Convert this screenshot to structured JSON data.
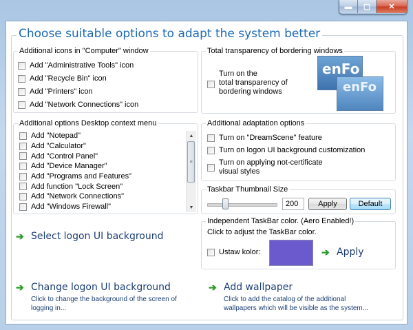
{
  "window": {
    "minimize_glyph": "▬",
    "maximize_glyph": "▢",
    "close_glyph": "✕"
  },
  "main": {
    "title": "Choose suitable options to adapt the system better"
  },
  "computer_icons": {
    "caption": "Additional icons in \"Computer\" window",
    "items": [
      {
        "label": "Add \"Administrative Tools\" icon",
        "checked": false
      },
      {
        "label": "Add \"Recycle Bin\" icon",
        "checked": false
      },
      {
        "label": "Add \"Printers\" icon",
        "checked": false
      },
      {
        "label": "Add \"Network Connections\" icon",
        "checked": false
      }
    ]
  },
  "transparency": {
    "caption": "Total transparency of bordering windows",
    "label": "Turn on the\ntotal transparency of\nbordering windows",
    "checked": false,
    "preview_text": "enFo"
  },
  "context_menu": {
    "caption": "Additional options Desktop context menu",
    "items": [
      {
        "label": "Add \"Notepad\""
      },
      {
        "label": "Add \"Calculator\""
      },
      {
        "label": "Add \"Control Panel\""
      },
      {
        "label": "Add \"Device Manager\""
      },
      {
        "label": "Add \"Programs and Features\""
      },
      {
        "label": "Add function \"Lock Screen\""
      },
      {
        "label": "Add \"Network Connections\""
      },
      {
        "label": "Add \"Windows Firewall\""
      }
    ],
    "scroll_up": "▲",
    "scroll_down": "▼",
    "grip": "≡"
  },
  "adaptation": {
    "caption": "Additional adaptation options",
    "items": [
      {
        "label": "Turn on \"DreamScene\" feature"
      },
      {
        "label": "Turn on logon UI background customization"
      },
      {
        "label": "Turn on applying not-certificate\nvisual styles"
      }
    ]
  },
  "thumbnail": {
    "caption": "Taskbar Thumbnail Size",
    "value": "200",
    "slider_fraction": 0.25,
    "apply_label": "Apply",
    "default_label": "Default"
  },
  "taskbar_color": {
    "caption": "Independent TaskBar color. (Aero Enabled!)",
    "hint": "Click to adjust the TaskBar color.",
    "checkbox_label": "Ustaw kolor:",
    "swatch_color": "#6a5acd",
    "apply_label": "Apply"
  },
  "links": {
    "select_logon": {
      "label": "Select logon UI background"
    },
    "change_logon": {
      "label": "Change logon UI background",
      "desc": "Click to change the background of the screen of\nlogging in..."
    },
    "add_wallpaper": {
      "label": "Add wallpaper",
      "desc": "Click to add the catalog of the additional\nwallpapers which will be visible as the system..."
    }
  },
  "colors": {
    "accent": "#1e6ab4",
    "link": "#1c3e73",
    "arrow": "#2c9a2a"
  }
}
